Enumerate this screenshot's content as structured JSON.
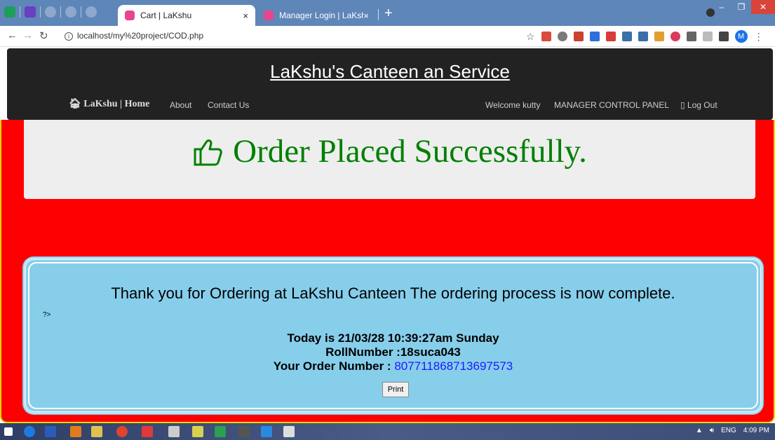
{
  "browser": {
    "tabs": [
      {
        "title": "Cart | LaKshu",
        "active": true
      },
      {
        "title": "Manager Login | LaKshu",
        "active": false
      }
    ],
    "close_glyph": "×",
    "new_tab_glyph": "+",
    "url": "localhost/my%20project/COD.php",
    "profile_initial": "M",
    "window_controls": [
      "–",
      "❐",
      "✕"
    ]
  },
  "site": {
    "title": "LaKshu's Canteen an Service",
    "brand": "LaKshu | Home",
    "nav_left": [
      "About",
      "Contact Us"
    ],
    "welcome": "Welcome kutty",
    "manager_panel": "MANAGER CONTROL PANEL",
    "logout": "Log Out"
  },
  "success": {
    "message": "Order Placed Successfully.",
    "icon": "thumbs-up-icon",
    "color": "#008000"
  },
  "confirmation": {
    "thanks": "Thank you for Ordering at LaKshu Canteen The ordering process is now complete.",
    "stray_text": "?>",
    "today_line": "Today is 21/03/28 10:39:27am Sunday",
    "roll_line": "RollNumber :18suca043",
    "order_label": "Your Order Number :",
    "order_number": "807711868713697573",
    "print_label": "Print"
  },
  "taskbar": {
    "language": "ENG",
    "time": "4:09 PM"
  },
  "colors": {
    "page_bg": "#ff0000",
    "header_bg": "#222222",
    "card_bg": "#87ceeb",
    "order_number": "#1a1aff"
  }
}
